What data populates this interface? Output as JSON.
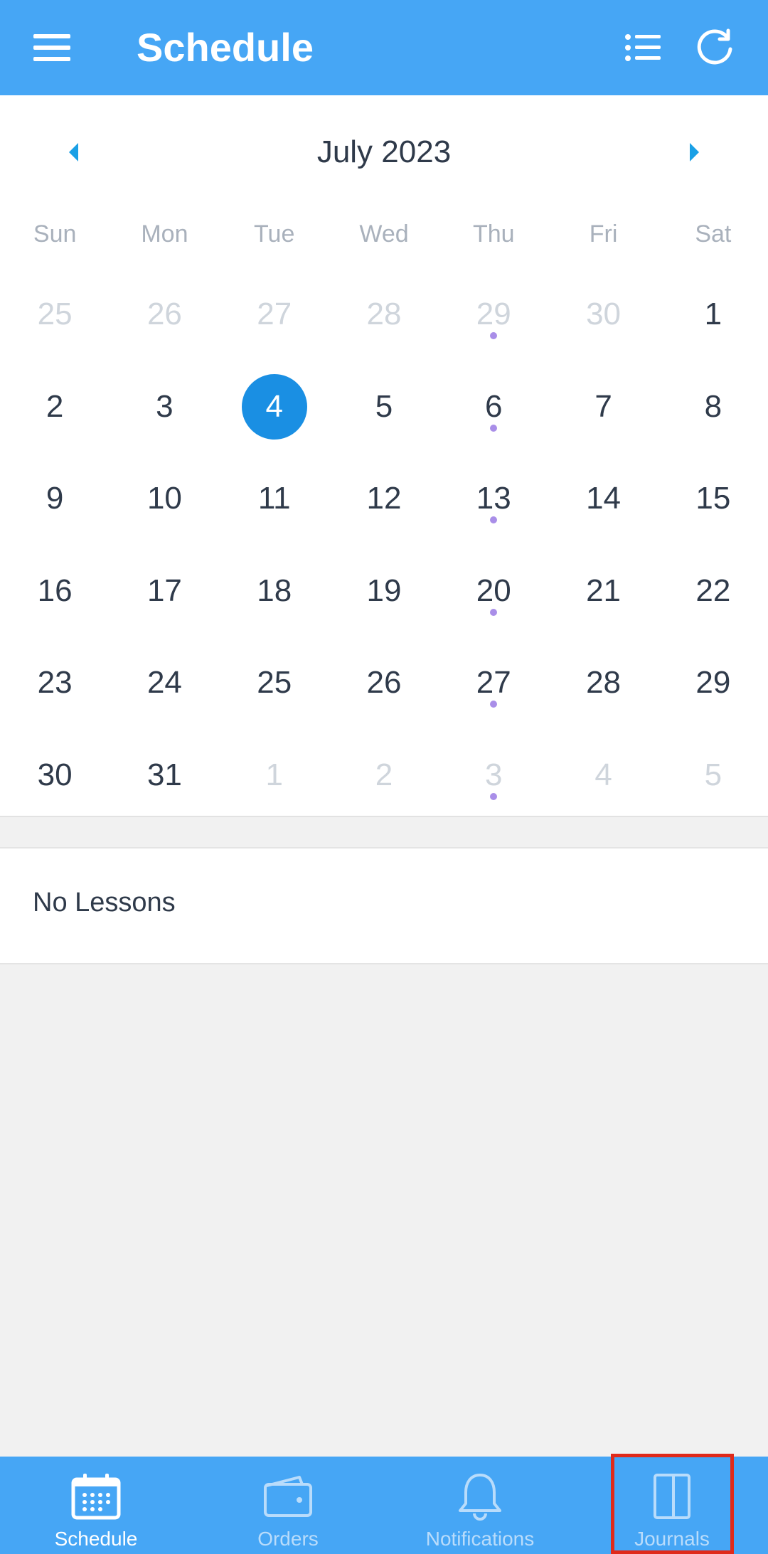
{
  "header": {
    "title": "Schedule"
  },
  "calendar": {
    "month_title": "July 2023",
    "weekdays": [
      "Sun",
      "Mon",
      "Tue",
      "Wed",
      "Thu",
      "Fri",
      "Sat"
    ],
    "days": [
      {
        "d": "25",
        "muted": true
      },
      {
        "d": "26",
        "muted": true
      },
      {
        "d": "27",
        "muted": true
      },
      {
        "d": "28",
        "muted": true
      },
      {
        "d": "29",
        "muted": true,
        "dot": true
      },
      {
        "d": "30",
        "muted": true
      },
      {
        "d": "1"
      },
      {
        "d": "2"
      },
      {
        "d": "3"
      },
      {
        "d": "4",
        "selected": true
      },
      {
        "d": "5"
      },
      {
        "d": "6",
        "dot": true
      },
      {
        "d": "7"
      },
      {
        "d": "8"
      },
      {
        "d": "9"
      },
      {
        "d": "10"
      },
      {
        "d": "11"
      },
      {
        "d": "12"
      },
      {
        "d": "13",
        "dot": true
      },
      {
        "d": "14"
      },
      {
        "d": "15"
      },
      {
        "d": "16"
      },
      {
        "d": "17"
      },
      {
        "d": "18"
      },
      {
        "d": "19"
      },
      {
        "d": "20",
        "dot": true
      },
      {
        "d": "21"
      },
      {
        "d": "22"
      },
      {
        "d": "23"
      },
      {
        "d": "24"
      },
      {
        "d": "25"
      },
      {
        "d": "26"
      },
      {
        "d": "27",
        "dot": true
      },
      {
        "d": "28"
      },
      {
        "d": "29"
      },
      {
        "d": "30"
      },
      {
        "d": "31"
      },
      {
        "d": "1",
        "muted": true
      },
      {
        "d": "2",
        "muted": true
      },
      {
        "d": "3",
        "muted": true,
        "dot": true
      },
      {
        "d": "4",
        "muted": true
      },
      {
        "d": "5",
        "muted": true
      }
    ]
  },
  "lessons": {
    "empty_text": "No Lessons"
  },
  "bottom_nav": {
    "items": [
      {
        "label": "Schedule",
        "icon": "calendar-icon",
        "active": true
      },
      {
        "label": "Orders",
        "icon": "wallet-icon"
      },
      {
        "label": "Notifications",
        "icon": "bell-icon"
      },
      {
        "label": "Journals",
        "icon": "journal-icon"
      }
    ]
  },
  "colors": {
    "primary": "#46a6f5",
    "selected_day": "#1a8fe3",
    "event_dot": "#a98ee8",
    "highlight": "#e02a1a"
  }
}
